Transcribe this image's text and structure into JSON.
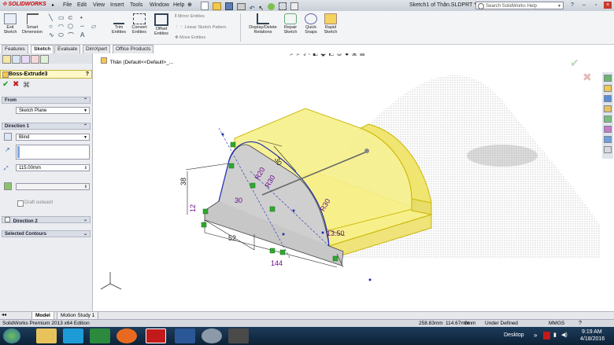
{
  "window": {
    "app_logo": "SOLIDWORKS",
    "menus": [
      "File",
      "Edit",
      "View",
      "Insert",
      "Tools",
      "Window",
      "Help"
    ],
    "document_title": "Sketch1 of Thân.SLDPRT *",
    "search_placeholder": "Search SolidWorks Help",
    "controls": [
      "?",
      "–",
      "▫",
      "×"
    ]
  },
  "command_manager": {
    "tools": [
      {
        "label": "Exit Sketch",
        "icon": "exit-sketch-icon"
      },
      {
        "label": "Smart Dimension",
        "icon": "smart-dimension-icon"
      },
      {
        "label": "Trim Entities",
        "icon": "trim-entities-icon"
      },
      {
        "label": "Convert Entities",
        "icon": "convert-entities-icon"
      },
      {
        "label": "Offset Entities",
        "icon": "offset-entities-icon"
      },
      {
        "label": "Display/Delete Relations",
        "icon": "relations-icon"
      },
      {
        "label": "Repair Sketch",
        "icon": "repair-sketch-icon"
      },
      {
        "label": "Quick Snaps",
        "icon": "quick-snaps-icon"
      },
      {
        "label": "Rapid Sketch",
        "icon": "rapid-sketch-icon"
      }
    ],
    "small_tools": [
      "Mirror Entities",
      "Linear Sketch Pattern",
      "Move Entities"
    ]
  },
  "tabs": [
    "Features",
    "Sketch",
    "Evaluate",
    "DimXpert",
    "Office Products"
  ],
  "active_tab": "Sketch",
  "feature_tree_node": "Thân  (Default<<Default>_...",
  "property_manager": {
    "title": "Boss-Extrude3",
    "help": "?",
    "sections": {
      "from": {
        "label": "From",
        "value": "Sketch Plane"
      },
      "direction1": {
        "label": "Direction 1",
        "end_condition": "Blind",
        "depth": "115.00mm",
        "draft_outward": "Draft outward"
      },
      "direction2": {
        "label": "Direction 2"
      },
      "selected_contours": {
        "label": "Selected Contours"
      }
    }
  },
  "dimensions": [
    "38",
    "30",
    "30",
    "R20",
    "R30",
    "12",
    "52",
    "144",
    "13.50",
    "R30"
  ],
  "bottom_tabs": [
    "Model",
    "Motion Study 1"
  ],
  "status_bar": {
    "edition": "SolidWorks Premium 2013 x64 Edition",
    "x": "258.83mm",
    "y": "114.67mm",
    "z": "0mm",
    "state": "Under Defined",
    "units": "MMGS"
  },
  "taskbar": {
    "desktop_label": "Desktop",
    "time": "9:19 AM",
    "date": "4/18/2016"
  },
  "colors": {
    "part_fill": "#f7f08a",
    "part_edge": "#c9b600",
    "sketch": "#1f2fb0",
    "dimension": "#6a0a8a",
    "relation": "#2fa82f"
  }
}
